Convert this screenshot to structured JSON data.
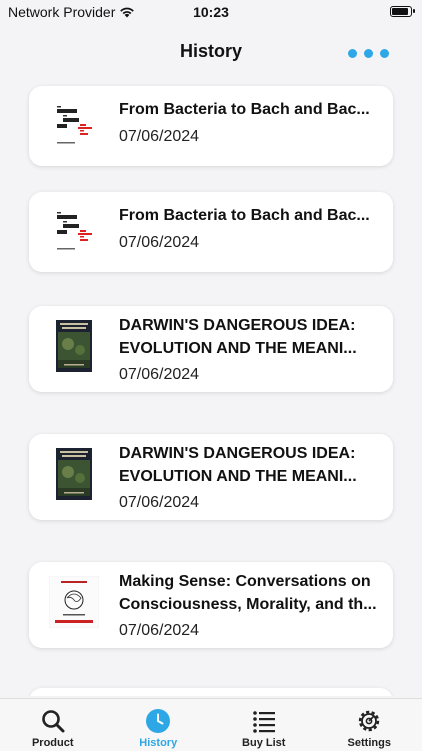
{
  "status_bar": {
    "carrier": "Network Provider",
    "time": "10:23"
  },
  "header": {
    "title": "History"
  },
  "history": {
    "items": [
      {
        "title": "From Bacteria to Bach and Bac...",
        "date": "07/06/2024",
        "cover": "bacteria-bach-cover"
      },
      {
        "title": "From Bacteria to Bach and Bac...",
        "date": "07/06/2024",
        "cover": "bacteria-bach-cover"
      },
      {
        "title": "DARWIN'S DANGEROUS IDEA: EVOLUTION AND THE MEANI...",
        "date": "07/06/2024",
        "cover": "darwins-dangerous-idea-cover"
      },
      {
        "title": "DARWIN'S DANGEROUS IDEA: EVOLUTION AND THE MEANI...",
        "date": "07/06/2024",
        "cover": "darwins-dangerous-idea-cover"
      },
      {
        "title": "Making Sense: Conversations on Consciousness, Morality, and th...",
        "date": "07/06/2024",
        "cover": "making-sense-cover"
      }
    ]
  },
  "tabbar": {
    "product": "Product",
    "history": "History",
    "buy_list": "Buy List",
    "settings": "Settings",
    "active": "history"
  },
  "colors": {
    "accent": "#2ea7e6"
  }
}
